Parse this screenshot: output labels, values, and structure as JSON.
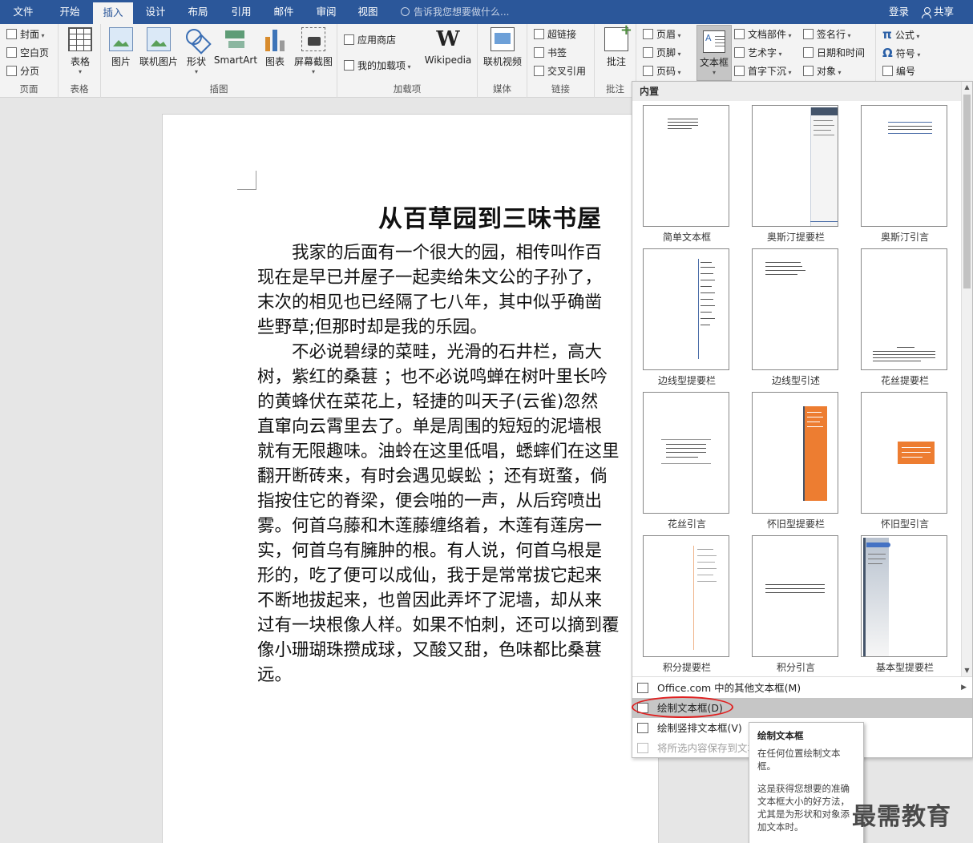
{
  "tabs": [
    "文件",
    "开始",
    "插入",
    "设计",
    "布局",
    "引用",
    "邮件",
    "审阅",
    "视图"
  ],
  "tell_me": "告诉我您想要做什么...",
  "login": "登录",
  "share": "共享",
  "ribbon": {
    "pages": {
      "cover": "封面",
      "blank": "空白页",
      "break": "分页",
      "label": "页面"
    },
    "tables": {
      "table": "表格",
      "label": "表格"
    },
    "illustrations": {
      "picture": "图片",
      "online_picture": "联机图片",
      "shapes": "形状",
      "smartart": "SmartArt",
      "chart": "图表",
      "screenshot": "屏幕截图",
      "label": "插图"
    },
    "addins": {
      "store": "应用商店",
      "my_addins": "我的加载项",
      "wikipedia": "Wikipedia",
      "label": "加载项"
    },
    "media": {
      "online_video": "联机视频",
      "label": "媒体"
    },
    "links": {
      "hyperlink": "超链接",
      "bookmark": "书签",
      "cross_ref": "交叉引用",
      "label": "链接"
    },
    "comments": {
      "comment": "批注",
      "label": "批注"
    },
    "header_footer": {
      "header": "页眉",
      "footer": "页脚",
      "page_number": "页码"
    },
    "text": {
      "textbox": "文本框",
      "quick_parts": "文档部件",
      "wordart": "艺术字",
      "dropcap": "首字下沉",
      "signature": "签名行",
      "datetime": "日期和时间",
      "object": "对象"
    },
    "symbols": {
      "equation": "公式",
      "symbol": "符号",
      "number": "编号"
    }
  },
  "document": {
    "title": "从百草园到三味书屋",
    "lines": [
      "　　我家的后面有一个很大的园，相传叫作百",
      "现在是早已并屋子一起卖给朱文公的子孙了，",
      "末次的相见也已经隔了七八年，其中似乎确凿",
      "些野草;但那时却是我的乐园。",
      "　　不必说碧绿的菜畦，光滑的石井栏，高大",
      "树，紫红的桑葚 ；也不必说鸣蝉在树叶里长吟",
      "的黄蜂伏在菜花上，轻捷的叫天子(云雀)忽然",
      "直窜向云霄里去了。单是周围的短短的泥墙根",
      "就有无限趣味。油蛉在这里低唱，蟋蟀们在这里",
      "翻开断砖来，有时会遇见蜈蚣 ；还有斑蝥，倘",
      "指按住它的脊梁，便会啪的一声，从后窍喷出",
      "雾。何首乌藤和木莲藤缠络着，木莲有莲房一",
      "实，何首乌有臃肿的根。有人说，何首乌根是",
      "形的，吃了便可以成仙，我于是常常拔它起来",
      "不断地拔起来，也曾因此弄坏了泥墙，却从来",
      "过有一块根像人样。如果不怕刺，还可以摘到覆",
      "像小珊瑚珠攒成球，又酸又甜，色味都比桑葚",
      "远。"
    ]
  },
  "gallery": {
    "section": "内置",
    "tiles": [
      "简单文本框",
      "奥斯汀提要栏",
      "奥斯汀引言",
      "边线型提要栏",
      "边线型引述",
      "花丝提要栏",
      "花丝引言",
      "怀旧型提要栏",
      "怀旧型引言",
      "积分提要栏",
      "积分引言",
      "基本型提要栏"
    ],
    "menu": [
      {
        "label": "Office.com 中的其他文本框(M)"
      },
      {
        "label": "绘制文本框(D)"
      },
      {
        "label": "绘制竖排文本框(V)"
      },
      {
        "label": "将所选内容保存到文本框库(S)"
      }
    ],
    "accent_orange": "#ed7d31",
    "accent_blue": "#44546a"
  },
  "tooltip": {
    "title": "绘制文本框",
    "line1": "在任何位置绘制文本框。",
    "line2": "这是获得您想要的准确文本框大小的好方法，尤其是为形状和对象添加文本时。"
  },
  "watermark": "最需教育"
}
